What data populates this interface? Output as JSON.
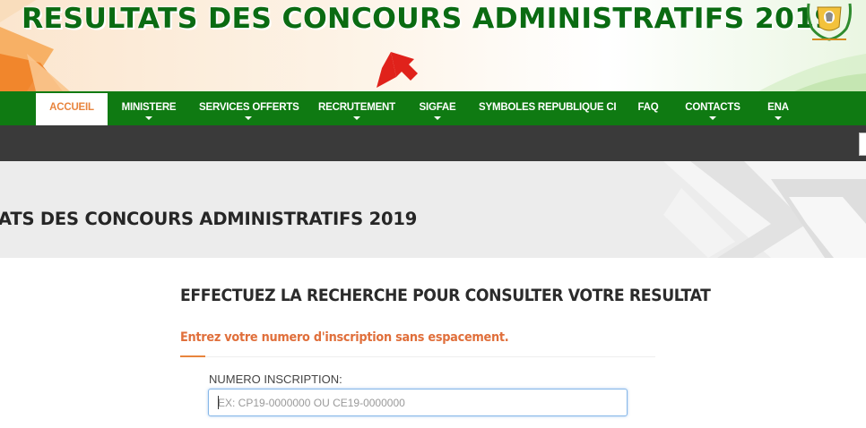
{
  "banner": {
    "title": "RESULTATS DES CONCOURS ADMINISTRATIFS 2019",
    "crest_icon": "coat-of-arms-icon",
    "arrow_icon": "red-arrow-icon",
    "colors": {
      "title": "#0a6b12",
      "arrow": "#e0221b"
    }
  },
  "nav": {
    "items": [
      {
        "label": "ACCUEIL",
        "active": true,
        "dropdown": false
      },
      {
        "label": "MINISTERE",
        "active": false,
        "dropdown": true
      },
      {
        "label": "SERVICES OFFERTS",
        "active": false,
        "dropdown": true
      },
      {
        "label": "RECRUTEMENT",
        "active": false,
        "dropdown": true
      },
      {
        "label": "SIGFAE",
        "active": false,
        "dropdown": true
      },
      {
        "label": "SYMBOLES REPUBLIQUE CI",
        "active": false,
        "dropdown": false
      },
      {
        "label": "FAQ",
        "active": false,
        "dropdown": false
      },
      {
        "label": "CONTACTS",
        "active": false,
        "dropdown": true
      },
      {
        "label": "ENA",
        "active": false,
        "dropdown": true
      }
    ],
    "colors": {
      "background": "#0f7a12",
      "active_text": "#e8843d"
    }
  },
  "page_header": {
    "title": "ATS DES CONCOURS ADMINISTRATIFS 2019"
  },
  "content": {
    "title": "EFFECTUEZ LA RECHERCHE POUR CONSULTER VOTRE RESULTAT",
    "subtitle": "Entrez votre numero d'inscription sans espacement.",
    "field": {
      "label": "NUMERO INSCRIPTION:",
      "placeholder": "EX: CP19-0000000 OU CE19-0000000",
      "value": ""
    },
    "colors": {
      "accent": "#e06f3b"
    }
  }
}
